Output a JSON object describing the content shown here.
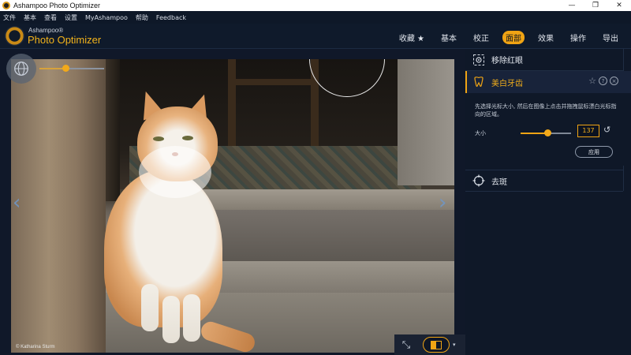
{
  "window": {
    "title": "Ashampoo Photo Optimizer",
    "controls": [
      "—",
      "❐",
      "✕"
    ]
  },
  "menu": [
    "文件",
    "基本",
    "查看",
    "设置",
    "MyAshampoo",
    "帮助",
    "Feedback"
  ],
  "brand": {
    "small": "Ashampoo®",
    "big": "Photo Optimizer",
    "accent_color": "#f0a414"
  },
  "nav": {
    "tabs": [
      "收藏 ★",
      "基本",
      "校正",
      "面部",
      "效果",
      "操作",
      "导出"
    ],
    "active": "面部"
  },
  "photo": {
    "credit": "© Katharina Sturm"
  },
  "zoom": {
    "level_fraction": 0.4
  },
  "panel": {
    "red_eye": "移除红眼",
    "teeth": {
      "title": "美白牙齿",
      "icons": [
        "star-icon",
        "help-icon",
        "close-icon"
      ],
      "instructions": "先选择光标大小, 然后在图像上点击并拖拽鼠标漂白光标指向的区域。",
      "size_label": "大小",
      "size_value": "137",
      "size_fraction": 0.55,
      "apply_label": "应用"
    },
    "blemish": "去斑"
  }
}
